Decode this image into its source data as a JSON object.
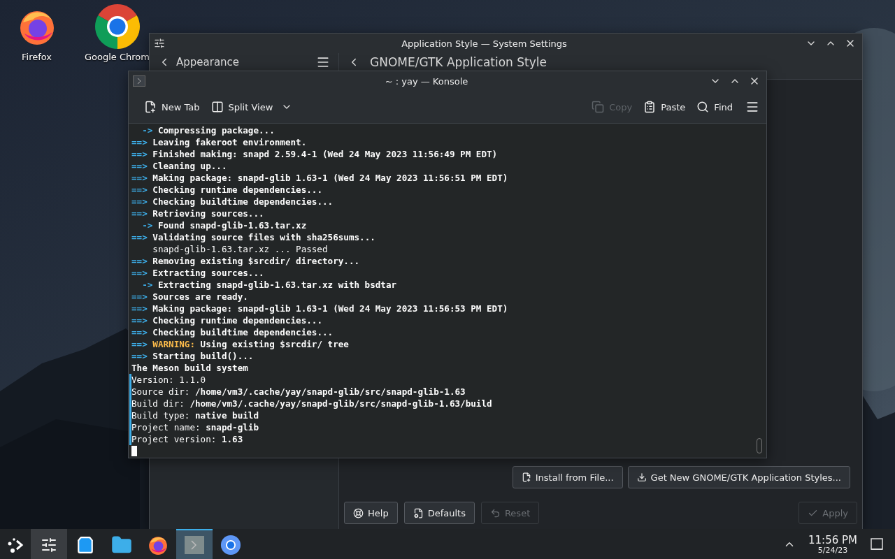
{
  "desktop_icons": [
    {
      "label": "Firefox",
      "kind": "firefox"
    },
    {
      "label": "Google Chrom",
      "kind": "chrome"
    }
  ],
  "settings_window": {
    "title": "Application Style — System Settings",
    "sidebar_header": "Appearance",
    "page_title": "GNOME/GTK Application Style",
    "actions": [
      {
        "label": "Install from File...",
        "kind": "install"
      },
      {
        "label": "Get New GNOME/GTK Application Styles...",
        "kind": "download"
      }
    ],
    "footer_buttons": [
      {
        "label": "Help",
        "kind": "help",
        "disabled": false
      },
      {
        "label": "Defaults",
        "kind": "defaults",
        "disabled": false
      },
      {
        "label": "Reset",
        "kind": "reset",
        "disabled": true
      },
      {
        "label": "Apply",
        "kind": "apply",
        "disabled": true
      }
    ]
  },
  "konsole": {
    "title": "~ : yay — Konsole",
    "toolbar": [
      {
        "label": "New Tab",
        "kind": "new_tab",
        "disabled": false
      },
      {
        "label": "Split View",
        "kind": "split_view",
        "disabled": false
      },
      {
        "label": "Copy",
        "kind": "copy",
        "disabled": true
      },
      {
        "label": "Paste",
        "kind": "paste",
        "disabled": false
      },
      {
        "label": "Find",
        "kind": "find",
        "disabled": false
      }
    ],
    "lines": [
      {
        "marked": false,
        "segments": [
          {
            "kind": "subarrow",
            "text": "->"
          },
          {
            "kind": "bold",
            "text": "Compressing package..."
          }
        ]
      },
      {
        "marked": false,
        "segments": [
          {
            "kind": "arrow",
            "text": "==>"
          },
          {
            "kind": "bold",
            "text": "Leaving fakeroot environment."
          }
        ]
      },
      {
        "marked": false,
        "segments": [
          {
            "kind": "arrow",
            "text": "==>"
          },
          {
            "kind": "bold",
            "text": "Finished making: snapd 2.59.4-1 (Wed 24 May 2023 11:56:49 PM EDT)"
          }
        ]
      },
      {
        "marked": false,
        "segments": [
          {
            "kind": "arrow",
            "text": "==>"
          },
          {
            "kind": "bold",
            "text": "Cleaning up..."
          }
        ]
      },
      {
        "marked": false,
        "segments": [
          {
            "kind": "arrow",
            "text": "==>"
          },
          {
            "kind": "bold",
            "text": "Making package: snapd-glib 1.63-1 (Wed 24 May 2023 11:56:51 PM EDT)"
          }
        ]
      },
      {
        "marked": false,
        "segments": [
          {
            "kind": "arrow",
            "text": "==>"
          },
          {
            "kind": "bold",
            "text": "Checking runtime dependencies..."
          }
        ]
      },
      {
        "marked": false,
        "segments": [
          {
            "kind": "arrow",
            "text": "==>"
          },
          {
            "kind": "bold",
            "text": "Checking buildtime dependencies..."
          }
        ]
      },
      {
        "marked": false,
        "segments": [
          {
            "kind": "arrow",
            "text": "==>"
          },
          {
            "kind": "bold",
            "text": "Retrieving sources..."
          }
        ]
      },
      {
        "marked": false,
        "segments": [
          {
            "kind": "subarrow",
            "text": "->"
          },
          {
            "kind": "bold",
            "text": "Found snapd-glib-1.63.tar.xz"
          }
        ]
      },
      {
        "marked": false,
        "segments": [
          {
            "kind": "arrow",
            "text": "==>"
          },
          {
            "kind": "bold",
            "text": "Validating source files with sha256sums..."
          }
        ]
      },
      {
        "marked": false,
        "segments": [
          {
            "kind": "indented",
            "text": "snapd-glib-1.63.tar.xz ... Passed"
          }
        ]
      },
      {
        "marked": false,
        "segments": [
          {
            "kind": "arrow",
            "text": "==>"
          },
          {
            "kind": "bold",
            "text": "Removing existing $srcdir/ directory..."
          }
        ]
      },
      {
        "marked": false,
        "segments": [
          {
            "kind": "arrow",
            "text": "==>"
          },
          {
            "kind": "bold",
            "text": "Extracting sources..."
          }
        ]
      },
      {
        "marked": false,
        "segments": [
          {
            "kind": "subarrow",
            "text": "->"
          },
          {
            "kind": "bold",
            "text": "Extracting snapd-glib-1.63.tar.xz with bsdtar"
          }
        ]
      },
      {
        "marked": false,
        "segments": [
          {
            "kind": "arrow",
            "text": "==>"
          },
          {
            "kind": "bold",
            "text": "Sources are ready."
          }
        ]
      },
      {
        "marked": false,
        "segments": [
          {
            "kind": "arrow",
            "text": "==>"
          },
          {
            "kind": "bold",
            "text": "Making package: snapd-glib 1.63-1 (Wed 24 May 2023 11:56:53 PM EDT)"
          }
        ]
      },
      {
        "marked": false,
        "segments": [
          {
            "kind": "arrow",
            "text": "==>"
          },
          {
            "kind": "bold",
            "text": "Checking runtime dependencies..."
          }
        ]
      },
      {
        "marked": false,
        "segments": [
          {
            "kind": "arrow",
            "text": "==>"
          },
          {
            "kind": "bold",
            "text": "Checking buildtime dependencies..."
          }
        ]
      },
      {
        "marked": false,
        "segments": [
          {
            "kind": "warn_arrow",
            "text": "==>"
          },
          {
            "kind": "warn",
            "text": "WARNING:"
          },
          {
            "kind": "bold",
            "text": "Using existing $srcdir/ tree"
          }
        ]
      },
      {
        "marked": false,
        "segments": [
          {
            "kind": "arrow",
            "text": "==>"
          },
          {
            "kind": "bold",
            "text": "Starting build()..."
          }
        ]
      },
      {
        "marked": false,
        "segments": [
          {
            "kind": "bold",
            "text": "The Meson build system"
          }
        ]
      },
      {
        "marked": true,
        "segments": [
          {
            "kind": "plain",
            "text": "Version: 1.1.0"
          }
        ]
      },
      {
        "marked": true,
        "segments": [
          {
            "kind": "plain",
            "text": "Source dir:"
          },
          {
            "kind": "bold",
            "text": "/home/vm3/.cache/yay/snapd-glib/src/snapd-glib-1.63"
          }
        ]
      },
      {
        "marked": true,
        "segments": [
          {
            "kind": "plain",
            "text": "Build dir:"
          },
          {
            "kind": "bold",
            "text": "/home/vm3/.cache/yay/snapd-glib/src/snapd-glib-1.63/build"
          }
        ]
      },
      {
        "marked": true,
        "segments": [
          {
            "kind": "plain",
            "text": "Build type:"
          },
          {
            "kind": "bold",
            "text": "native build"
          }
        ]
      },
      {
        "marked": true,
        "segments": [
          {
            "kind": "plain",
            "text": "Project name:"
          },
          {
            "kind": "bold",
            "text": "snapd-glib"
          }
        ]
      },
      {
        "marked": true,
        "segments": [
          {
            "kind": "plain",
            "text": "Project version:"
          },
          {
            "kind": "bold",
            "text": "1.63"
          }
        ]
      }
    ]
  },
  "taskbar": {
    "apps": [
      {
        "kind": "settings",
        "running": true,
        "selected": false
      },
      {
        "kind": "discover",
        "running": false,
        "selected": false
      },
      {
        "kind": "files",
        "running": false,
        "selected": false
      },
      {
        "kind": "firefox",
        "running": false,
        "selected": false
      },
      {
        "kind": "konsole",
        "running": true,
        "selected": true
      },
      {
        "kind": "chromium",
        "running": false,
        "selected": false
      }
    ],
    "clock": {
      "time": "11:56 PM",
      "date": "5/24/23"
    }
  }
}
